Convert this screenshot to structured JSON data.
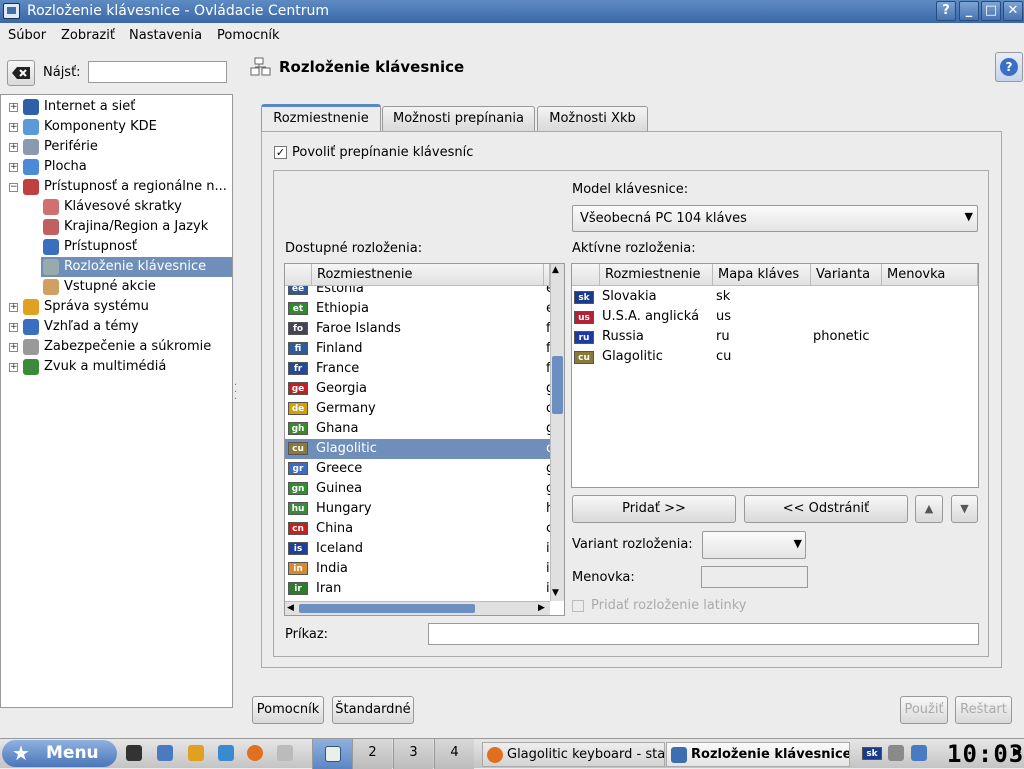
{
  "window": {
    "title": "Rozloženie klávesnice - Ovládacie Centrum",
    "help_btn": "?",
    "min_btn": "_",
    "max_btn": "□",
    "close_btn": "✕"
  },
  "menubar": [
    "Súbor",
    "Zobraziť",
    "Nastavenia",
    "Pomocník"
  ],
  "search": {
    "label": "Nájsť:",
    "value": ""
  },
  "tree": [
    {
      "label": "Internet a sieť",
      "exp": "+",
      "indent": 0
    },
    {
      "label": "Komponenty KDE",
      "exp": "+",
      "indent": 0
    },
    {
      "label": "Periférie",
      "exp": "+",
      "indent": 0
    },
    {
      "label": "Plocha",
      "exp": "+",
      "indent": 0
    },
    {
      "label": "Prístupnosť a regionálne n...",
      "exp": "−",
      "indent": 0
    },
    {
      "label": "Klávesové skratky",
      "exp": "",
      "indent": 1
    },
    {
      "label": "Krajina/Region a Jazyk",
      "exp": "",
      "indent": 1
    },
    {
      "label": "Prístupnosť",
      "exp": "",
      "indent": 1
    },
    {
      "label": "Rozloženie klávesnice",
      "exp": "",
      "indent": 1,
      "selected": true
    },
    {
      "label": "Vstupné akcie",
      "exp": "",
      "indent": 1
    },
    {
      "label": "Správa systému",
      "exp": "+",
      "indent": 0
    },
    {
      "label": "Vzhľad a témy",
      "exp": "+",
      "indent": 0
    },
    {
      "label": "Zabezpečenie a súkromie",
      "exp": "+",
      "indent": 0
    },
    {
      "label": "Zvuk a multimédiá",
      "exp": "+",
      "indent": 0
    }
  ],
  "module": {
    "title": "Rozloženie klávesnice",
    "help_icon": "?"
  },
  "tabs": [
    "Rozmiestnenie",
    "Možnosti prepínania",
    "Možnosti Xkb"
  ],
  "enable_switch": {
    "label": "Povoliť prepínanie klávesníc",
    "checked": true
  },
  "model": {
    "label": "Model klávesnice:",
    "value": "Všeobecná PC 104 kláves"
  },
  "available": {
    "label": "Dostupné rozloženia:",
    "header": "Rozmiestnenie",
    "rows": [
      {
        "flag": "ee",
        "name": "Estonia",
        "code": "e",
        "color": "#2a5a9a"
      },
      {
        "flag": "et",
        "name": "Ethiopia",
        "code": "e",
        "color": "#2d8a2d"
      },
      {
        "flag": "fo",
        "name": "Faroe Islands",
        "code": "f",
        "color": "#445"
      },
      {
        "flag": "fi",
        "name": "Finland",
        "code": "f",
        "color": "#2e5b9e"
      },
      {
        "flag": "fr",
        "name": "France",
        "code": "f",
        "color": "#24489a"
      },
      {
        "flag": "ge",
        "name": "Georgia",
        "code": "g",
        "color": "#c02020"
      },
      {
        "flag": "de",
        "name": "Germany",
        "code": "d",
        "color": "#d4a000"
      },
      {
        "flag": "gh",
        "name": "Ghana",
        "code": "g",
        "color": "#3a8a2a"
      },
      {
        "flag": "cu",
        "name": "Glagolitic",
        "code": "c",
        "color": "#8a7a3a",
        "selected": true
      },
      {
        "flag": "gr",
        "name": "Greece",
        "code": "g",
        "color": "#3b6cc0"
      },
      {
        "flag": "gn",
        "name": "Guinea",
        "code": "g",
        "color": "#2f8f2f"
      },
      {
        "flag": "hu",
        "name": "Hungary",
        "code": "h",
        "color": "#3a8a3a"
      },
      {
        "flag": "cn",
        "name": "China",
        "code": "c",
        "color": "#c81e1e"
      },
      {
        "flag": "is",
        "name": "Iceland",
        "code": "i",
        "color": "#1e3f9a"
      },
      {
        "flag": "in",
        "name": "India",
        "code": "i",
        "color": "#d58a30"
      },
      {
        "flag": "ir",
        "name": "Iran",
        "code": "i",
        "color": "#2e7a2e"
      }
    ]
  },
  "active": {
    "label": "Aktívne rozloženia:",
    "headers": [
      "Rozmiestnenie",
      "Mapa kláves",
      "Varianta",
      "Menovka"
    ],
    "rows": [
      {
        "flag": "sk",
        "name": "Slovakia",
        "map": "sk",
        "variant": "",
        "label": "",
        "color": "#1a3a8a"
      },
      {
        "flag": "us",
        "name": "U.S.A. anglická",
        "map": "us",
        "variant": "",
        "label": "",
        "color": "#b22234"
      },
      {
        "flag": "ru",
        "name": "Russia",
        "map": "ru",
        "variant": "phonetic",
        "label": "",
        "color": "#1c3aa0"
      },
      {
        "flag": "cu",
        "name": "Glagolitic",
        "map": "cu",
        "variant": "",
        "label": "",
        "color": "#8a7a3a"
      }
    ]
  },
  "buttons": {
    "add": "Pridať >>",
    "remove": "<< Odstrániť",
    "up": "▲",
    "down": "▼"
  },
  "variant": {
    "label": "Variant rozloženia:",
    "value": ""
  },
  "menovka": {
    "label": "Menovka:",
    "value": ""
  },
  "latin": {
    "label": "Pridať rozloženie latinky",
    "checked": false
  },
  "command": {
    "label": "Príkaz:",
    "value": ""
  },
  "bottom": {
    "help": "Pomocník",
    "defaults": "Štandardné",
    "apply": "Použiť",
    "reset": "Reštart"
  },
  "taskbar": {
    "menu": "Menu",
    "desktops": [
      "2",
      "3",
      "4"
    ],
    "tasks": [
      "Glagolitic keyboard - sta",
      "Rozloženie klávesnice"
    ],
    "kbd_flag": "sk",
    "clock": "10:03"
  }
}
